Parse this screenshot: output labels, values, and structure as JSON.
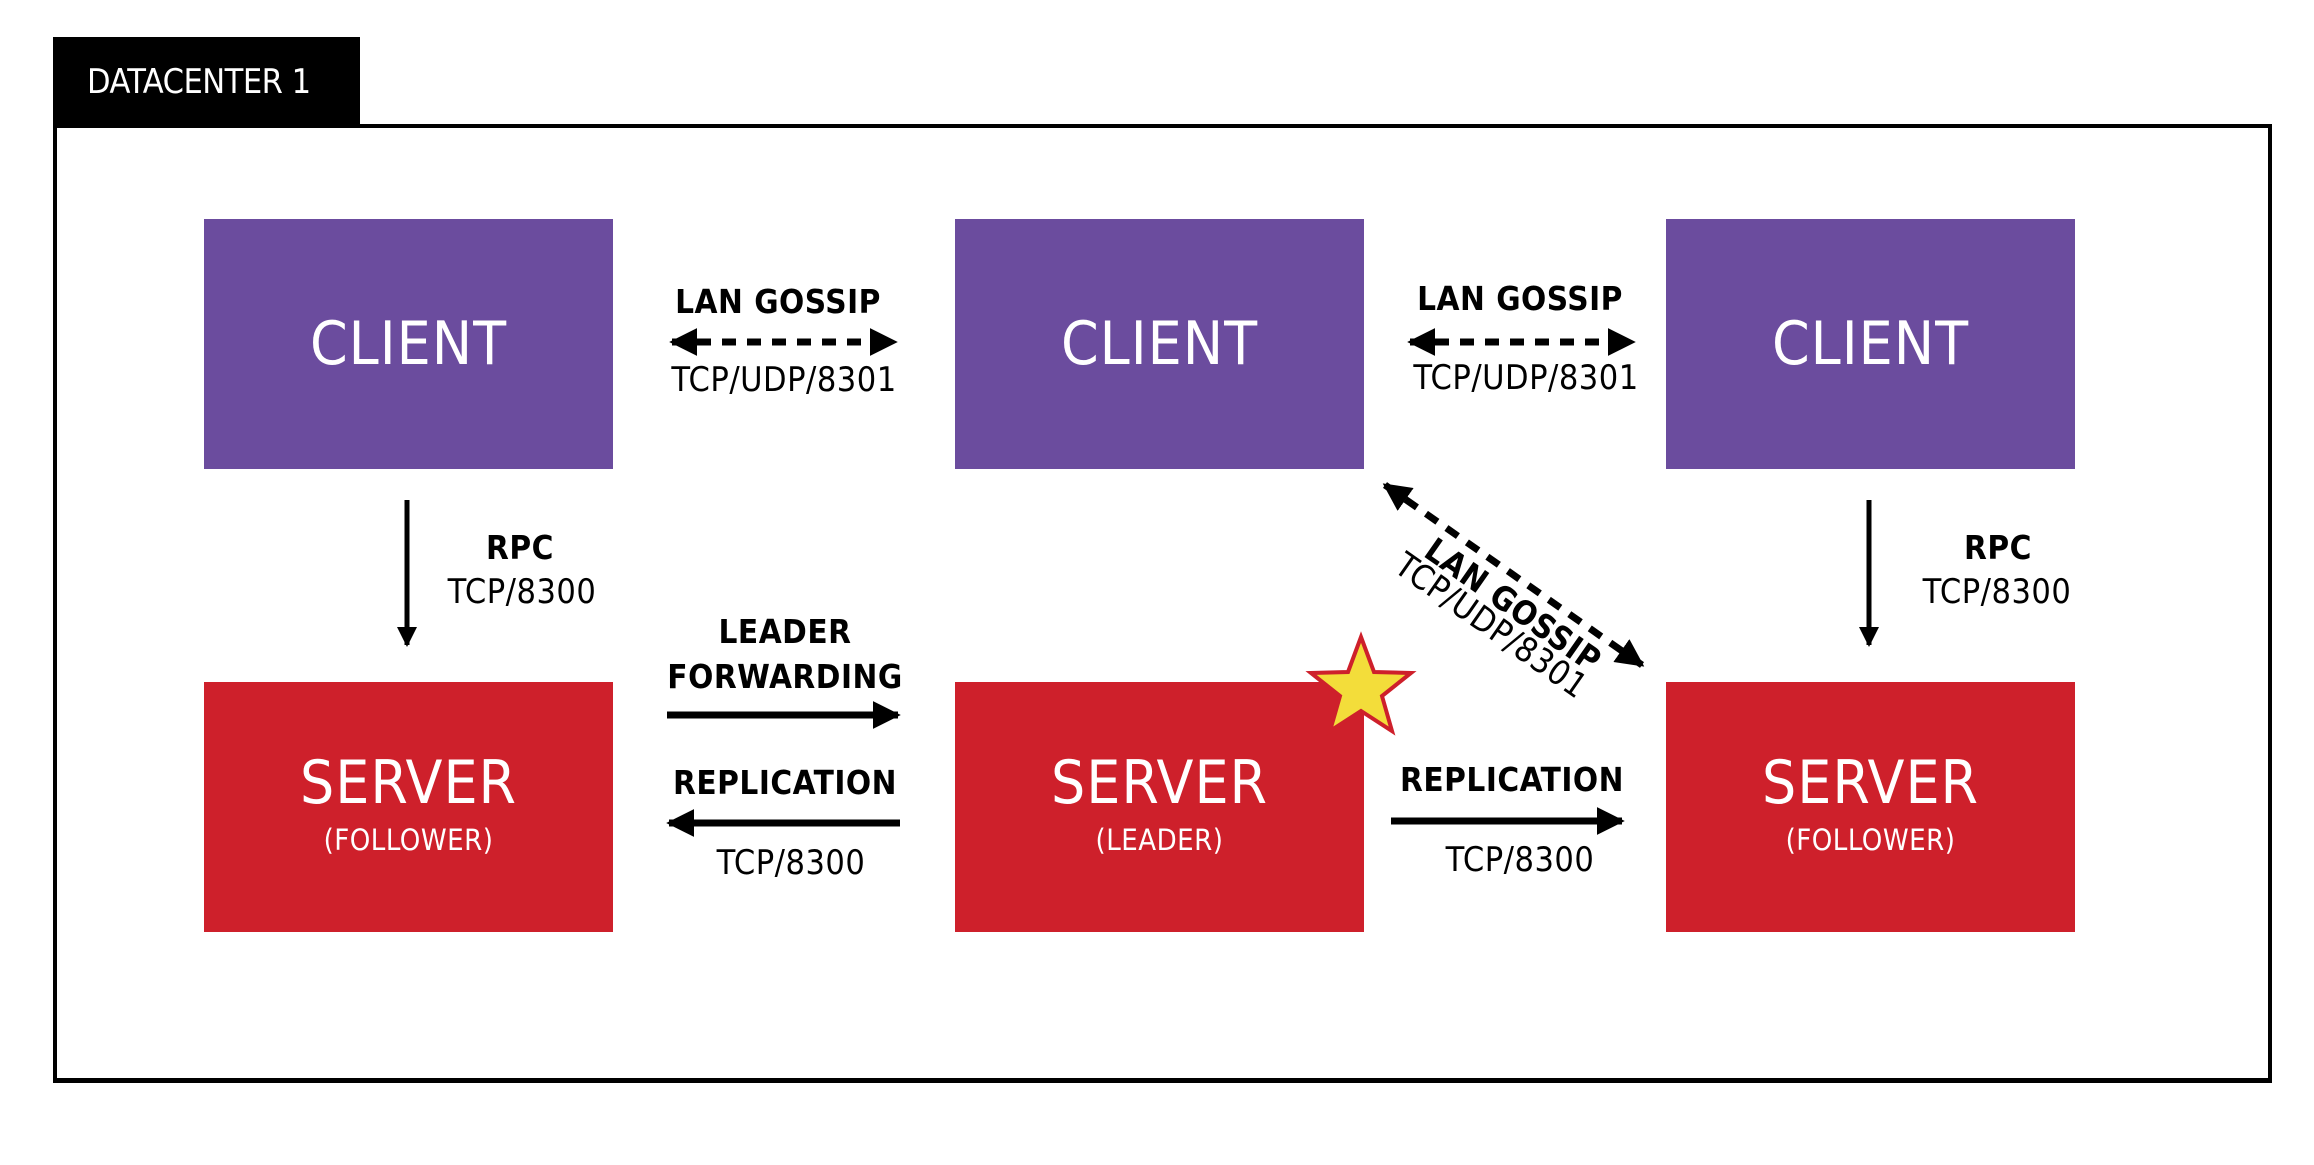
{
  "datacenter": {
    "label": "DATACENTER 1"
  },
  "colors": {
    "client": "#6B4C9E",
    "server": "#CE202B",
    "star_fill": "#F3DD3A",
    "star_stroke": "#CE202B",
    "frame": "#000000"
  },
  "clients": [
    {
      "label": "CLIENT"
    },
    {
      "label": "CLIENT"
    },
    {
      "label": "CLIENT"
    }
  ],
  "servers": [
    {
      "label": "SERVER",
      "role": "(FOLLOWER)"
    },
    {
      "label": "SERVER",
      "role": "(LEADER)",
      "leader_icon": "star-icon"
    },
    {
      "label": "SERVER",
      "role": "(FOLLOWER)"
    }
  ],
  "connections": {
    "gossip_left": {
      "title": "LAN GOSSIP",
      "port": "TCP/UDP/8301",
      "style": "dashed-bidirectional"
    },
    "gossip_right": {
      "title": "LAN GOSSIP",
      "port": "TCP/UDP/8301",
      "style": "dashed-bidirectional"
    },
    "gossip_diagonal": {
      "title": "LAN GOSSIP",
      "port": "TCP/UDP/8301",
      "style": "dashed-bidirectional"
    },
    "rpc_left": {
      "title": "RPC",
      "port": "TCP/8300",
      "style": "solid-down"
    },
    "rpc_right": {
      "title": "RPC",
      "port": "TCP/8300",
      "style": "solid-down"
    },
    "leader_forwarding": {
      "title_line1": "LEADER",
      "title_line2": "FORWARDING",
      "style": "solid-right"
    },
    "replication_left": {
      "title": "REPLICATION",
      "port": "TCP/8300",
      "style": "solid-left"
    },
    "replication_right": {
      "title": "REPLICATION",
      "port": "TCP/8300",
      "style": "solid-right"
    }
  }
}
